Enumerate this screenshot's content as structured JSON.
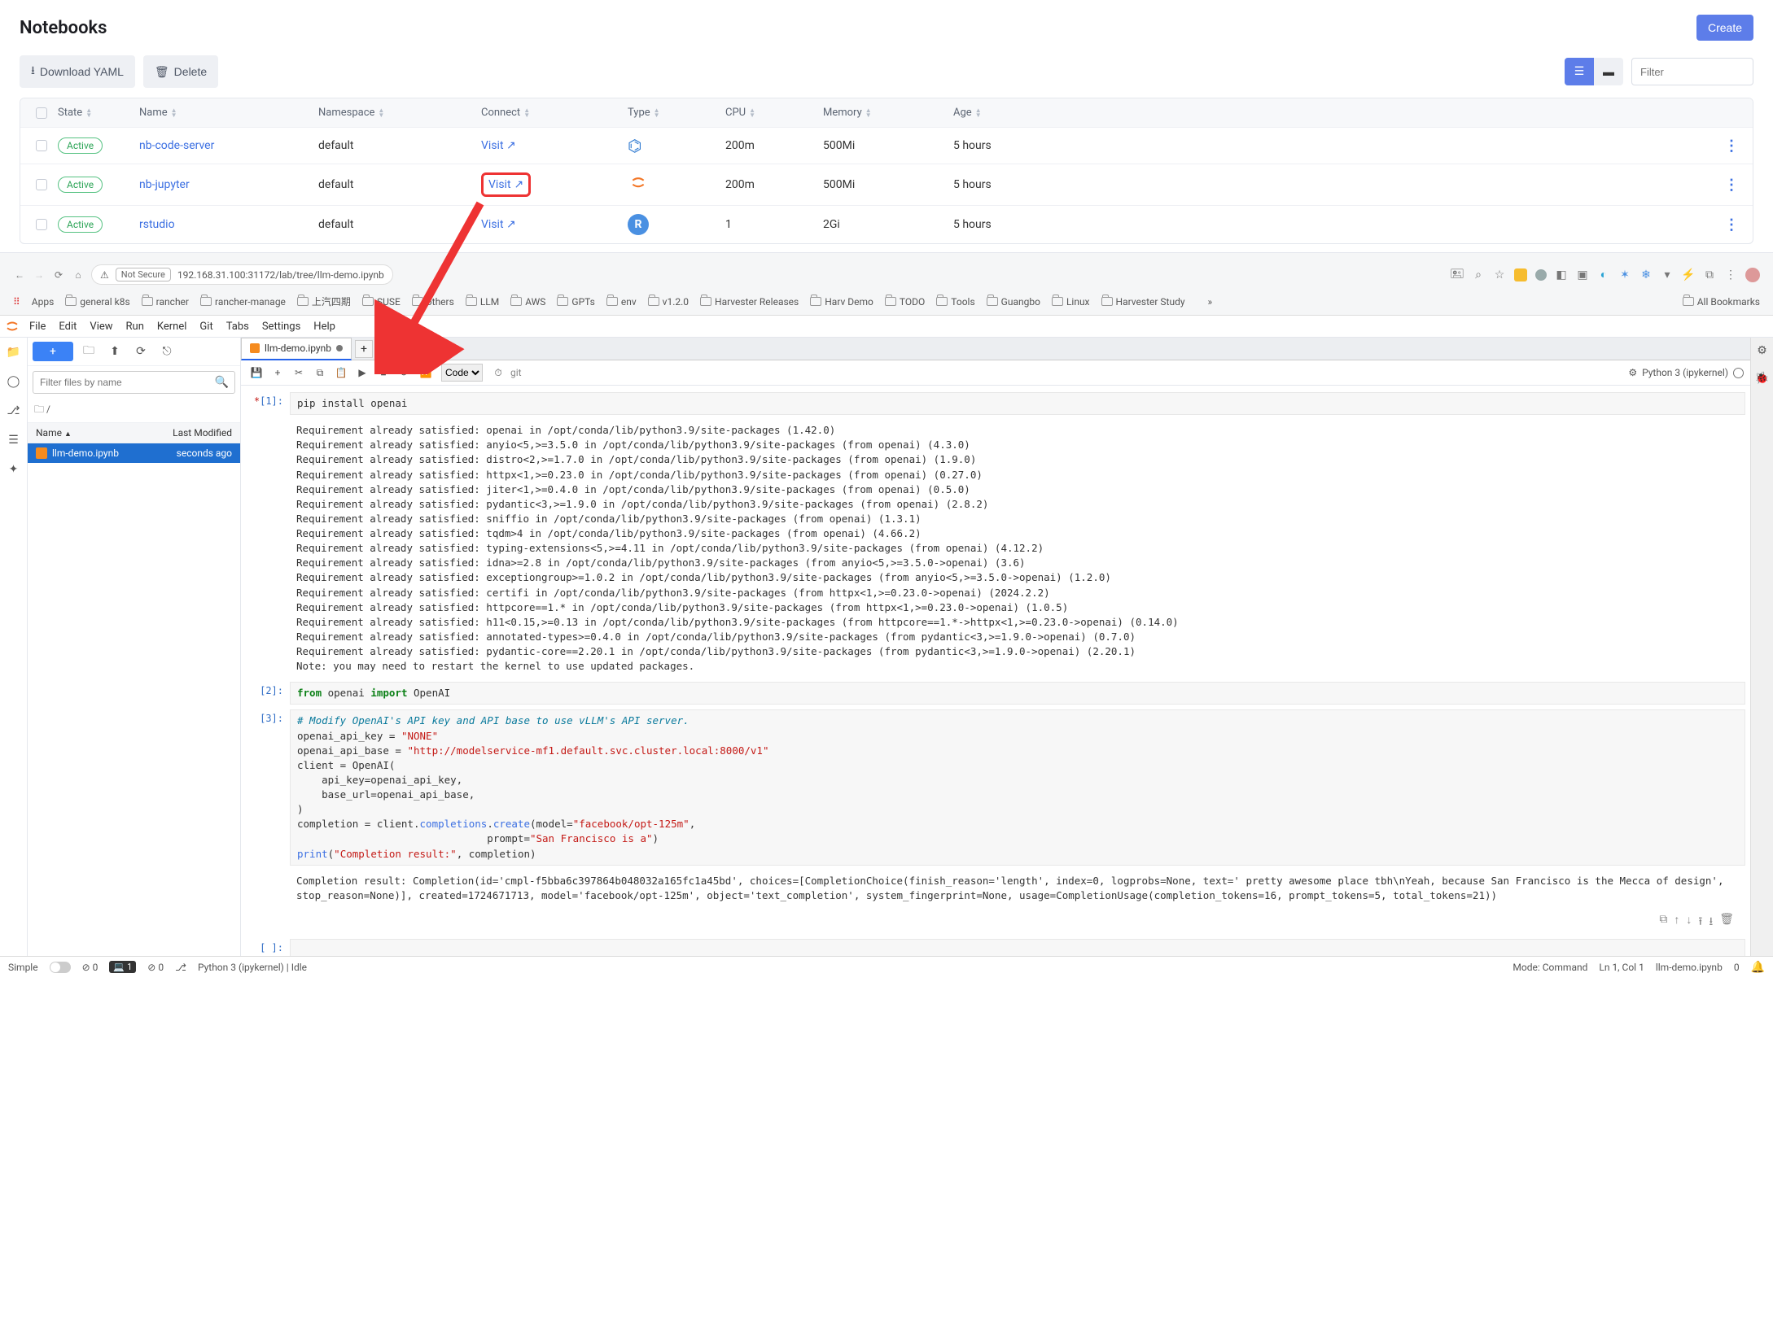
{
  "mgr": {
    "title": "Notebooks",
    "create": "Create",
    "download": "Download YAML",
    "delete": "Delete",
    "filter_ph": "Filter",
    "cols": {
      "state": "State",
      "name": "Name",
      "ns": "Namespace",
      "connect": "Connect",
      "type": "Type",
      "cpu": "CPU",
      "mem": "Memory",
      "age": "Age"
    },
    "rows": [
      {
        "state": "Active",
        "name": "nb-code-server",
        "ns": "default",
        "connect": "Visit",
        "type": "vscode",
        "cpu": "200m",
        "mem": "500Mi",
        "age": "5 hours",
        "hl": false
      },
      {
        "state": "Active",
        "name": "nb-jupyter",
        "ns": "default",
        "connect": "Visit",
        "type": "jupyter",
        "cpu": "200m",
        "mem": "500Mi",
        "age": "5 hours",
        "hl": true
      },
      {
        "state": "Active",
        "name": "rstudio",
        "ns": "default",
        "connect": "Visit",
        "type": "r",
        "cpu": "1",
        "mem": "2Gi",
        "age": "5 hours",
        "hl": false
      }
    ]
  },
  "chrome": {
    "not_secure": "Not Secure",
    "url": "192.168.31.100:31172/lab/tree/llm-demo.ipynb",
    "apps": "Apps",
    "bookmarks": [
      "general k8s",
      "rancher",
      "rancher-manage",
      "上汽四期",
      "SUSE",
      "others",
      "LLM",
      "AWS",
      "GPTs",
      "env",
      "v1.2.0",
      "Harvester Releases",
      "Harv Demo",
      "TODO",
      "Tools",
      "Guangbo",
      "Linux",
      "Harvester Study"
    ],
    "all_bookmarks": "All Bookmarks"
  },
  "jup": {
    "menu": [
      "File",
      "Edit",
      "View",
      "Run",
      "Kernel",
      "Git",
      "Tabs",
      "Settings",
      "Help"
    ],
    "filter_ph": "Filter files by name",
    "bc_root": "/",
    "fb_hdr_name": "Name",
    "fb_hdr_mod": "Last Modified",
    "file_name": "llm-demo.ipynb",
    "file_mod": "seconds ago",
    "tab_title": "llm-demo.ipynb",
    "celltype": "Code",
    "git_label": "git",
    "kernel": "Python 3 (ipykernel)",
    "cells": {
      "c1_prompt": "[1]:",
      "c1_code": "pip install openai",
      "c1_out": "Requirement already satisfied: openai in /opt/conda/lib/python3.9/site-packages (1.42.0)\nRequirement already satisfied: anyio<5,>=3.5.0 in /opt/conda/lib/python3.9/site-packages (from openai) (4.3.0)\nRequirement already satisfied: distro<2,>=1.7.0 in /opt/conda/lib/python3.9/site-packages (from openai) (1.9.0)\nRequirement already satisfied: httpx<1,>=0.23.0 in /opt/conda/lib/python3.9/site-packages (from openai) (0.27.0)\nRequirement already satisfied: jiter<1,>=0.4.0 in /opt/conda/lib/python3.9/site-packages (from openai) (0.5.0)\nRequirement already satisfied: pydantic<3,>=1.9.0 in /opt/conda/lib/python3.9/site-packages (from openai) (2.8.2)\nRequirement already satisfied: sniffio in /opt/conda/lib/python3.9/site-packages (from openai) (1.3.1)\nRequirement already satisfied: tqdm>4 in /opt/conda/lib/python3.9/site-packages (from openai) (4.66.2)\nRequirement already satisfied: typing-extensions<5,>=4.11 in /opt/conda/lib/python3.9/site-packages (from openai) (4.12.2)\nRequirement already satisfied: idna>=2.8 in /opt/conda/lib/python3.9/site-packages (from anyio<5,>=3.5.0->openai) (3.6)\nRequirement already satisfied: exceptiongroup>=1.0.2 in /opt/conda/lib/python3.9/site-packages (from anyio<5,>=3.5.0->openai) (1.2.0)\nRequirement already satisfied: certifi in /opt/conda/lib/python3.9/site-packages (from httpx<1,>=0.23.0->openai) (2024.2.2)\nRequirement already satisfied: httpcore==1.* in /opt/conda/lib/python3.9/site-packages (from httpx<1,>=0.23.0->openai) (1.0.5)\nRequirement already satisfied: h11<0.15,>=0.13 in /opt/conda/lib/python3.9/site-packages (from httpcore==1.*->httpx<1,>=0.23.0->openai) (0.14.0)\nRequirement already satisfied: annotated-types>=0.4.0 in /opt/conda/lib/python3.9/site-packages (from pydantic<3,>=1.9.0->openai) (0.7.0)\nRequirement already satisfied: pydantic-core==2.20.1 in /opt/conda/lib/python3.9/site-packages (from pydantic<3,>=1.9.0->openai) (2.20.1)\nNote: you may need to restart the kernel to use updated packages.",
      "c2_prompt": "[2]:",
      "c3_prompt": "[3]:",
      "c4_prompt": "[ ]:",
      "c3_out": "Completion result: Completion(id='cmpl-f5bba6c397864b048032a165fc1a45bd', choices=[CompletionChoice(finish_reason='length', index=0, logprobs=None, text=' pretty awesome place tbh\\nYeah, because San Francisco is the Mecca of design', stop_reason=None)], created=1724671713, model='facebook/opt-125m', object='text_completion', system_fingerprint=None, usage=CompletionUsage(completion_tokens=16, prompt_tokens=5, total_tokens=21))"
    },
    "code2": {
      "kw_from": "from",
      "mod": " openai ",
      "kw_import": "import",
      "cls": " OpenAI"
    },
    "code3": {
      "comment": "# Modify OpenAI's API key and API base to use vLLM's API server.",
      "l1a": "openai_api_key = ",
      "l1b": "\"NONE\"",
      "l2a": "openai_api_base = ",
      "l2b": "\"http://modelservice-mf1.default.svc.cluster.local:8000/v1\"",
      "l3": "client = OpenAI(",
      "l4": "    api_key=openai_api_key,",
      "l5": "    base_url=openai_api_base,",
      "l6": ")",
      "l7a": "completion = client.",
      "l7b": "completions",
      "l7c": ".",
      "l7d": "create",
      "l7e": "(model=",
      "l7f": "\"facebook/opt-125m\"",
      "l7g": ",",
      "l8a": "                               prompt=",
      "l8b": "\"San Francisco is a\"",
      "l8c": ")",
      "l9a": "print",
      "l9b": "(",
      "l9c": "\"Completion result:\"",
      "l9d": ", completion)"
    }
  },
  "sbar": {
    "simple": "Simple",
    "zero1": "0",
    "gitcount": "1",
    "zero2": "0",
    "kernel": "Python 3 (ipykernel) | Idle",
    "mode": "Mode: Command",
    "pos": "Ln 1, Col 1",
    "file": "llm-demo.ipynb",
    "n0": "0"
  }
}
